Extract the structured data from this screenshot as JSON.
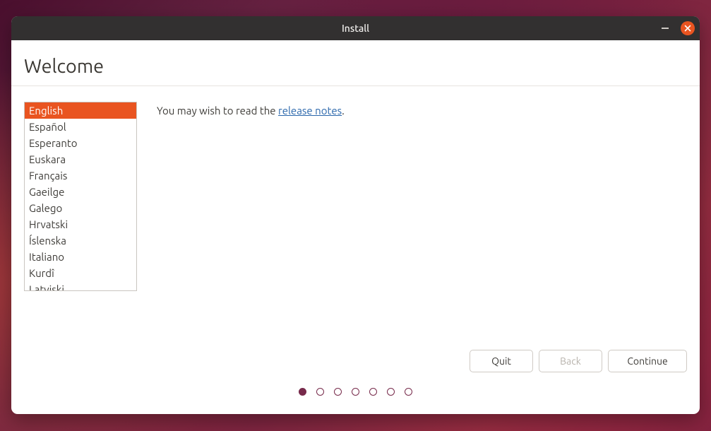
{
  "window": {
    "title": "Install"
  },
  "header": {
    "title": "Welcome"
  },
  "languages": {
    "selected_index": 0,
    "items": [
      "English",
      "Español",
      "Esperanto",
      "Euskara",
      "Français",
      "Gaeilge",
      "Galego",
      "Hrvatski",
      "Íslenska",
      "Italiano",
      "Kurdî",
      "Latviski"
    ]
  },
  "content": {
    "prefix": "You may wish to read the ",
    "link_text": "release notes",
    "suffix": "."
  },
  "buttons": {
    "quit": "Quit",
    "back": "Back",
    "continue": "Continue"
  },
  "progress": {
    "total": 7,
    "current": 0
  },
  "colors": {
    "accent": "#e95420",
    "link": "#2966ab",
    "progress_dot": "#772a4b"
  }
}
